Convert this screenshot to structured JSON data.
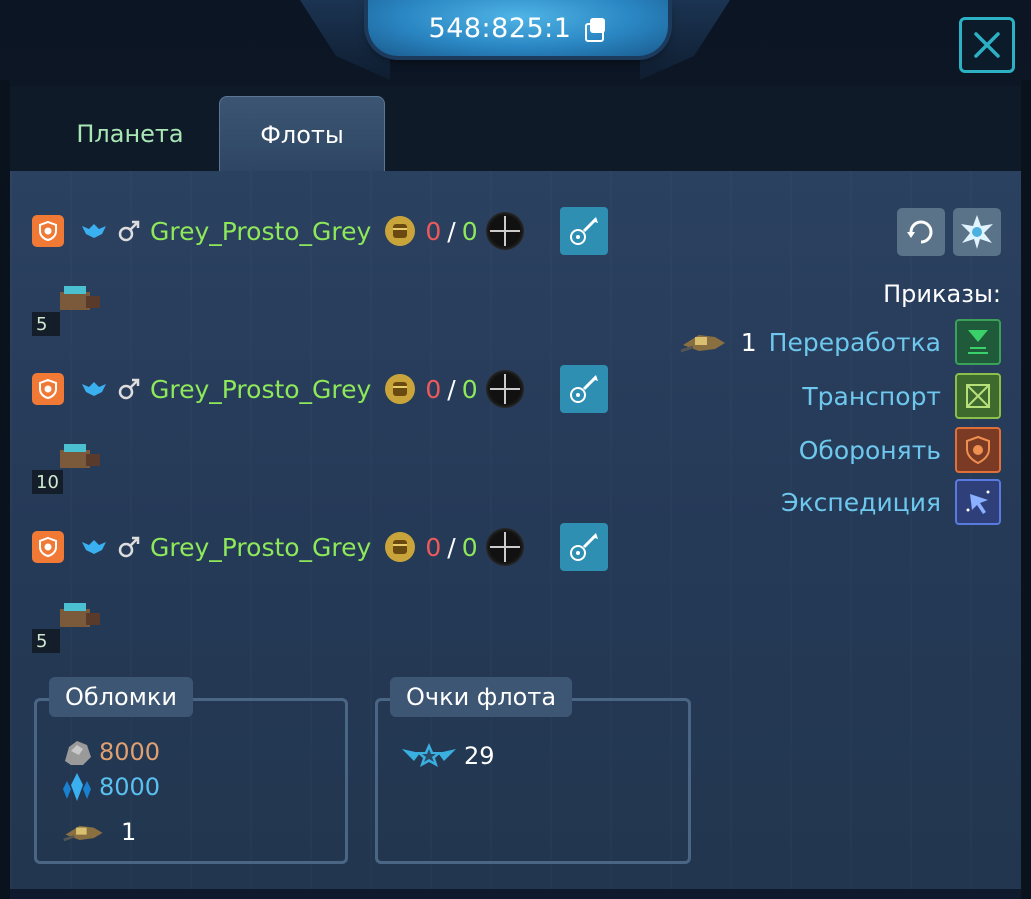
{
  "header": {
    "coordinates": "548:825:1",
    "copy_icon": "copy-icon",
    "close_icon": "close-icon"
  },
  "tabs": [
    {
      "label": "Планета",
      "active": false
    },
    {
      "label": "Флоты",
      "active": true
    }
  ],
  "fleets": [
    {
      "player": "Grey_Prosto_Grey",
      "wins": "0",
      "sep": "/",
      "losses": "0",
      "ship_count": "5"
    },
    {
      "player": "Grey_Prosto_Grey",
      "wins": "0",
      "sep": "/",
      "losses": "0",
      "ship_count": "10"
    },
    {
      "player": "Grey_Prosto_Grey",
      "wins": "0",
      "sep": "/",
      "losses": "0",
      "ship_count": "5"
    }
  ],
  "orders": {
    "title": "Приказы:",
    "recycle_count": "1",
    "items": [
      {
        "label": "Переработка",
        "icon": "recycle-icon"
      },
      {
        "label": "Транспорт",
        "icon": "transport-icon"
      },
      {
        "label": "Оборонять",
        "icon": "defend-icon"
      },
      {
        "label": "Экспедиция",
        "icon": "expedition-icon"
      }
    ]
  },
  "debris": {
    "title": "Обломки",
    "metal": "8000",
    "crystal": "8000",
    "recyclers": "1"
  },
  "fleet_points": {
    "title": "Очки флота",
    "value": "29"
  },
  "colors": {
    "name_green": "#8ee85a",
    "wins_red": "#ee5a5a",
    "order_blue": "#6ec8ee",
    "metal": "#e0a070",
    "crystal": "#5ac0f0"
  }
}
